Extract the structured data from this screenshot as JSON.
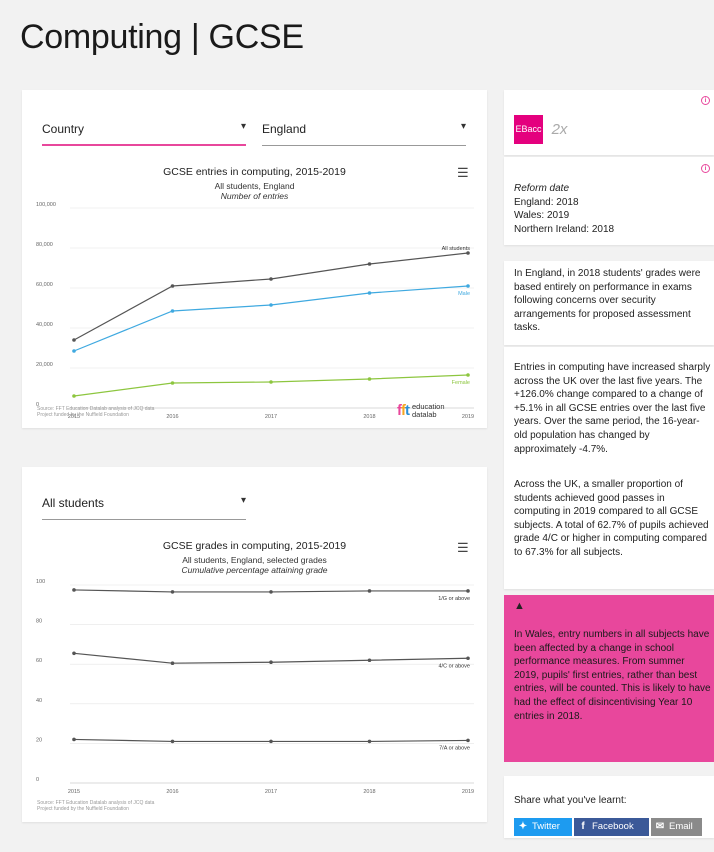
{
  "page": {
    "title": "Computing | GCSE"
  },
  "entries_panel": {
    "filter_country": {
      "label": "Country"
    },
    "filter_region": {
      "label": "England"
    },
    "chart_title": "GCSE entries in computing, 2015-2019",
    "chart_subtitle_1": "All students, England",
    "chart_subtitle_2": "Number of entries",
    "source_1": "Source: FFT Education Datalab analysis of JCQ data",
    "source_2": "Project funded by the Nuffield Foundation",
    "logo_text_1": "education",
    "logo_text_2": "datalab"
  },
  "grades_panel": {
    "filter_students": {
      "label": "All students"
    },
    "chart_title": "GCSE grades in computing, 2015-2019",
    "chart_subtitle_1": "All students, England, selected grades",
    "chart_subtitle_2": "Cumulative percentage attaining grade",
    "source_1": "Source: FFT Education Datalab analysis of JCQ data",
    "source_2": "Project funded by the Nuffield Foundation"
  },
  "chart_data": [
    {
      "type": "line",
      "title": "GCSE entries in computing, 2015-2019",
      "x": [
        "2015",
        "2016",
        "2017",
        "2018",
        "2019"
      ],
      "ylim": [
        0,
        100000
      ],
      "yticks": [
        "0",
        "20,000",
        "40,000",
        "60,000",
        "80,000",
        "100,000"
      ],
      "grid": true,
      "series": [
        {
          "name": "All students",
          "color": "#555555",
          "values": [
            34000,
            61000,
            64500,
            72000,
            77500
          ]
        },
        {
          "name": "Male",
          "color": "#3fa9e0",
          "values": [
            28500,
            48500,
            51500,
            57500,
            61000
          ]
        },
        {
          "name": "Female",
          "color": "#8dc63f",
          "values": [
            6000,
            12500,
            13000,
            14500,
            16500
          ]
        }
      ]
    },
    {
      "type": "line",
      "title": "GCSE grades in computing, 2015-2019",
      "x": [
        "2015",
        "2016",
        "2017",
        "2018",
        "2019"
      ],
      "ylim": [
        0,
        100
      ],
      "yticks": [
        "0",
        "20",
        "40",
        "60",
        "80",
        "100"
      ],
      "grid": true,
      "series": [
        {
          "name": "1/G or above",
          "color": "#555555",
          "values": [
            97.5,
            96.5,
            96.5,
            97,
            97
          ]
        },
        {
          "name": "4/C or above",
          "color": "#555555",
          "values": [
            65.5,
            60.5,
            61,
            62,
            63
          ]
        },
        {
          "name": "7/A or above",
          "color": "#555555",
          "values": [
            22,
            21,
            21,
            21,
            21.5
          ]
        }
      ]
    }
  ],
  "sidebar": {
    "ebacc_label": "EBacc",
    "twox_label": "2x",
    "reform_heading": "Reform date",
    "reform_england": "England: 2018",
    "reform_wales": "Wales: 2019",
    "reform_ni": "Northern Ireland: 2018",
    "para_england": "In England, in 2018 students' grades were based entirely on performance in exams following concerns over security arrangements for proposed assessment tasks.",
    "para_entries": "Entries in computing have increased sharply across the UK over the last five years. The +126.0% change compared to a change of +5.1% in all GCSE entries over the last five years. Over the same period, the 16-year-old population has changed by approximately -4.7%.",
    "para_passes": "Across the UK, a smaller proportion of students achieved good passes in computing in 2019 compared to all GCSE subjects. A total of 62.7% of pupils achieved grade 4/C or higher in computing compared to 67.3% for all subjects.",
    "warning_text": "In Wales, entry numbers in all subjects have been affected by a change in school performance measures. From summer 2019, pupils' first entries, rather than best entries, will be counted. This is likely to have had the effect of disincentivising Year 10 entries in 2018.",
    "share_heading": "Share what you've learnt:",
    "share_twitter": "Twitter",
    "share_facebook": "Facebook",
    "share_email": "Email",
    "colors": {
      "accent": "#e8479c",
      "ebacc": "#e4007e",
      "twitter": "#1d9bf0",
      "facebook": "#3b5998",
      "email": "#8a8a8a"
    }
  }
}
